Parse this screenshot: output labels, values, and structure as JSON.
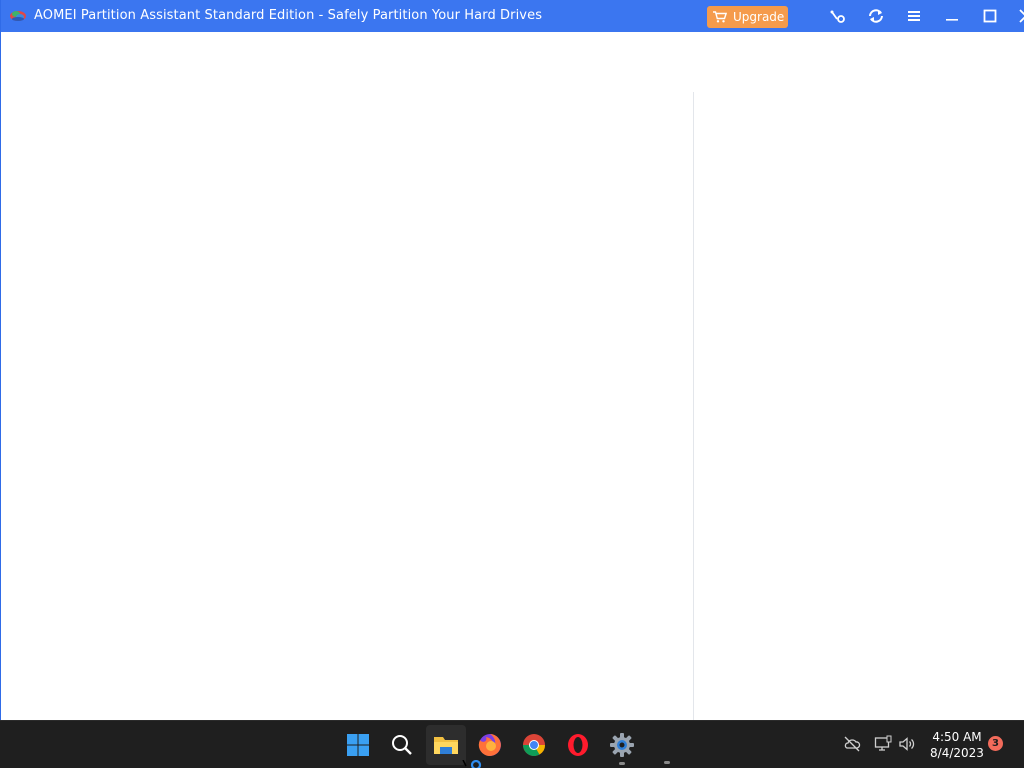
{
  "window": {
    "title": "AOMEI Partition Assistant Standard Edition - Safely Partition Your Hard Drives",
    "upgrade_label": "Upgrade",
    "titlebar_icons": [
      "feedback-icon",
      "refresh-icon",
      "menu-icon",
      "minimize-icon",
      "maximize-icon",
      "close-icon"
    ],
    "accent_color": "#3b76f0",
    "upgrade_color": "#f59b4c"
  },
  "taskbar": {
    "apps": [
      {
        "name": "start-button",
        "icon": "windows-logo-icon"
      },
      {
        "name": "search-button",
        "icon": "search-icon"
      },
      {
        "name": "file-explorer",
        "icon": "folder-icon",
        "active": true
      },
      {
        "name": "firefox",
        "icon": "firefox-icon"
      },
      {
        "name": "chrome",
        "icon": "chrome-icon"
      },
      {
        "name": "opera",
        "icon": "opera-icon"
      },
      {
        "name": "aomei-partition-assistant",
        "icon": "gear-icon",
        "running": true
      }
    ],
    "clock": {
      "time": "4:50 AM",
      "date": "8/4/2023"
    },
    "notification_count": "3",
    "tray_icons": [
      "cloud-offline-icon",
      "network-icon",
      "volume-icon"
    ]
  }
}
